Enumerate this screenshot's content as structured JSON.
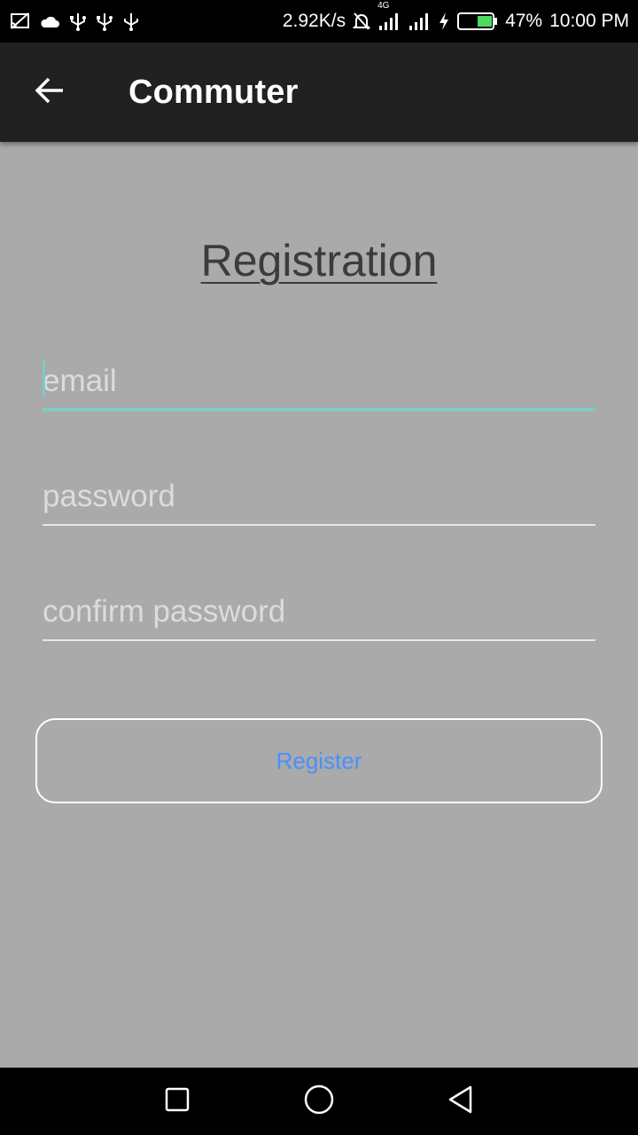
{
  "status_bar": {
    "icons_left": [
      "cast-off-icon",
      "cloud-icon",
      "usb-icon",
      "usb-icon",
      "usb-icon"
    ],
    "speed": "2.92K/s",
    "network_label": "4G",
    "battery": "47%",
    "time": "10:00 PM"
  },
  "app_bar": {
    "title": "Commuter",
    "back_icon": "arrow-left-icon"
  },
  "form": {
    "heading": "Registration",
    "email_placeholder": "email",
    "password_placeholder": "password",
    "confirm_placeholder": "confirm password",
    "register_label": "Register"
  },
  "colors": {
    "background": "#aaaaaa",
    "app_bar": "#212121",
    "accent": "#80cbc4",
    "button_text": "#4a90ff"
  },
  "nav_bar": {
    "icons": [
      "recent-apps-icon",
      "home-icon",
      "back-icon"
    ]
  }
}
